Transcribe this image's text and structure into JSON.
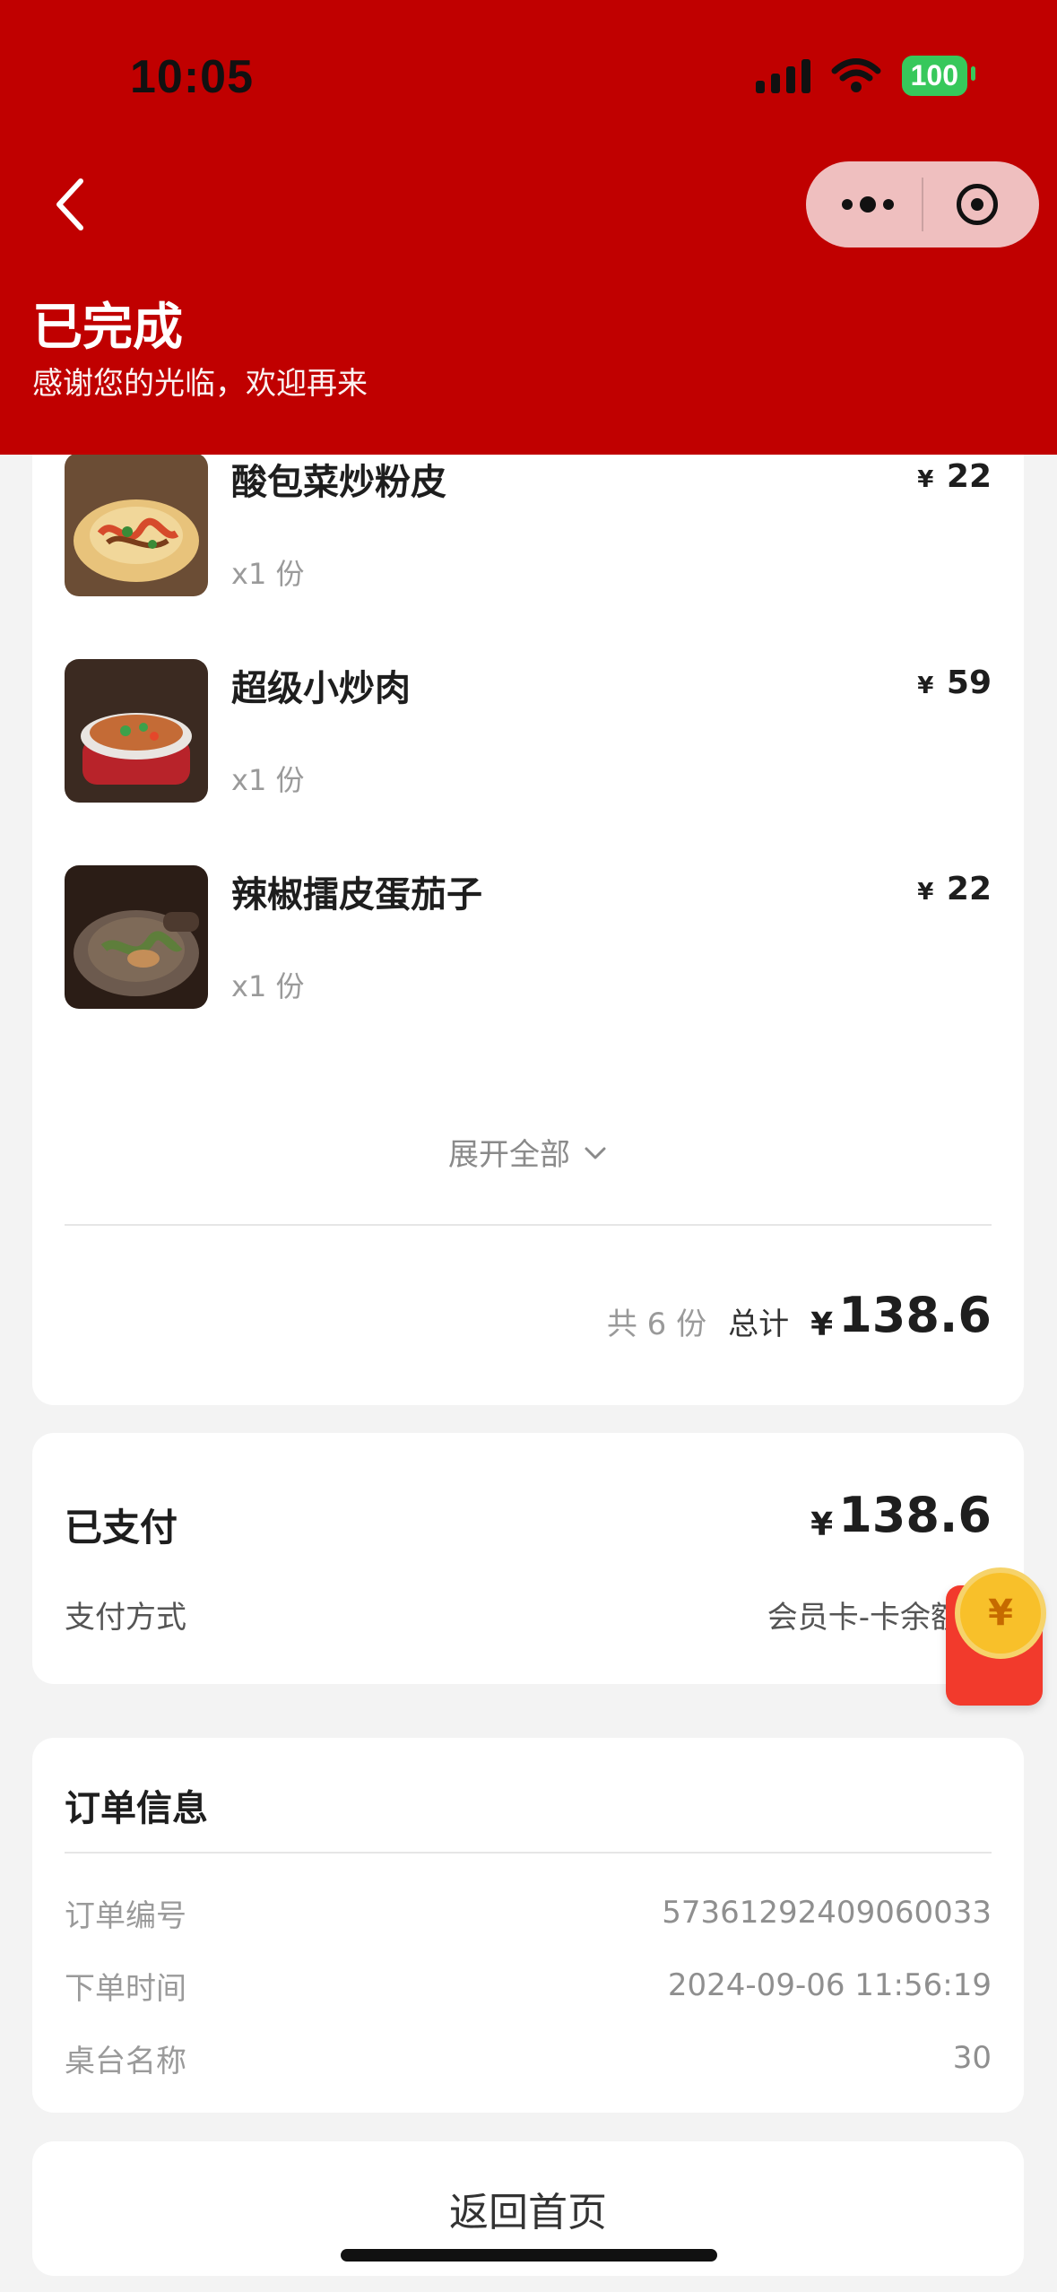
{
  "status_bar": {
    "time": "10:05",
    "battery": "100"
  },
  "header": {
    "title": "已完成",
    "subtitle": "感谢您的光临，欢迎再来"
  },
  "items": [
    {
      "name": "酸包菜炒粉皮",
      "qty": "x1 份",
      "price": "22"
    },
    {
      "name": "超级小炒肉",
      "qty": "x1 份",
      "price": "59"
    },
    {
      "name": "辣椒擂皮蛋茄子",
      "qty": "x1 份",
      "price": "22"
    }
  ],
  "currency": "¥",
  "expand": {
    "label": "展开全部"
  },
  "summary": {
    "count": "共 6 份",
    "label": "总计",
    "amount": "138.6"
  },
  "payment": {
    "title": "已支付",
    "amount": "138.6",
    "method_label": "支付方式",
    "method_value": "会员卡-卡余额消"
  },
  "order": {
    "title": "订单信息",
    "number_label": "订单编号",
    "number_value": "57361292409060033",
    "time_label": "下单时间",
    "time_value": "2024-09-06 11:56:19",
    "table_label": "桌台名称",
    "table_value": "30"
  },
  "home": {
    "label": "返回首页"
  },
  "colors": {
    "brand": "#C00000",
    "background": "#F3F3F3",
    "card": "#FFFFFF"
  }
}
